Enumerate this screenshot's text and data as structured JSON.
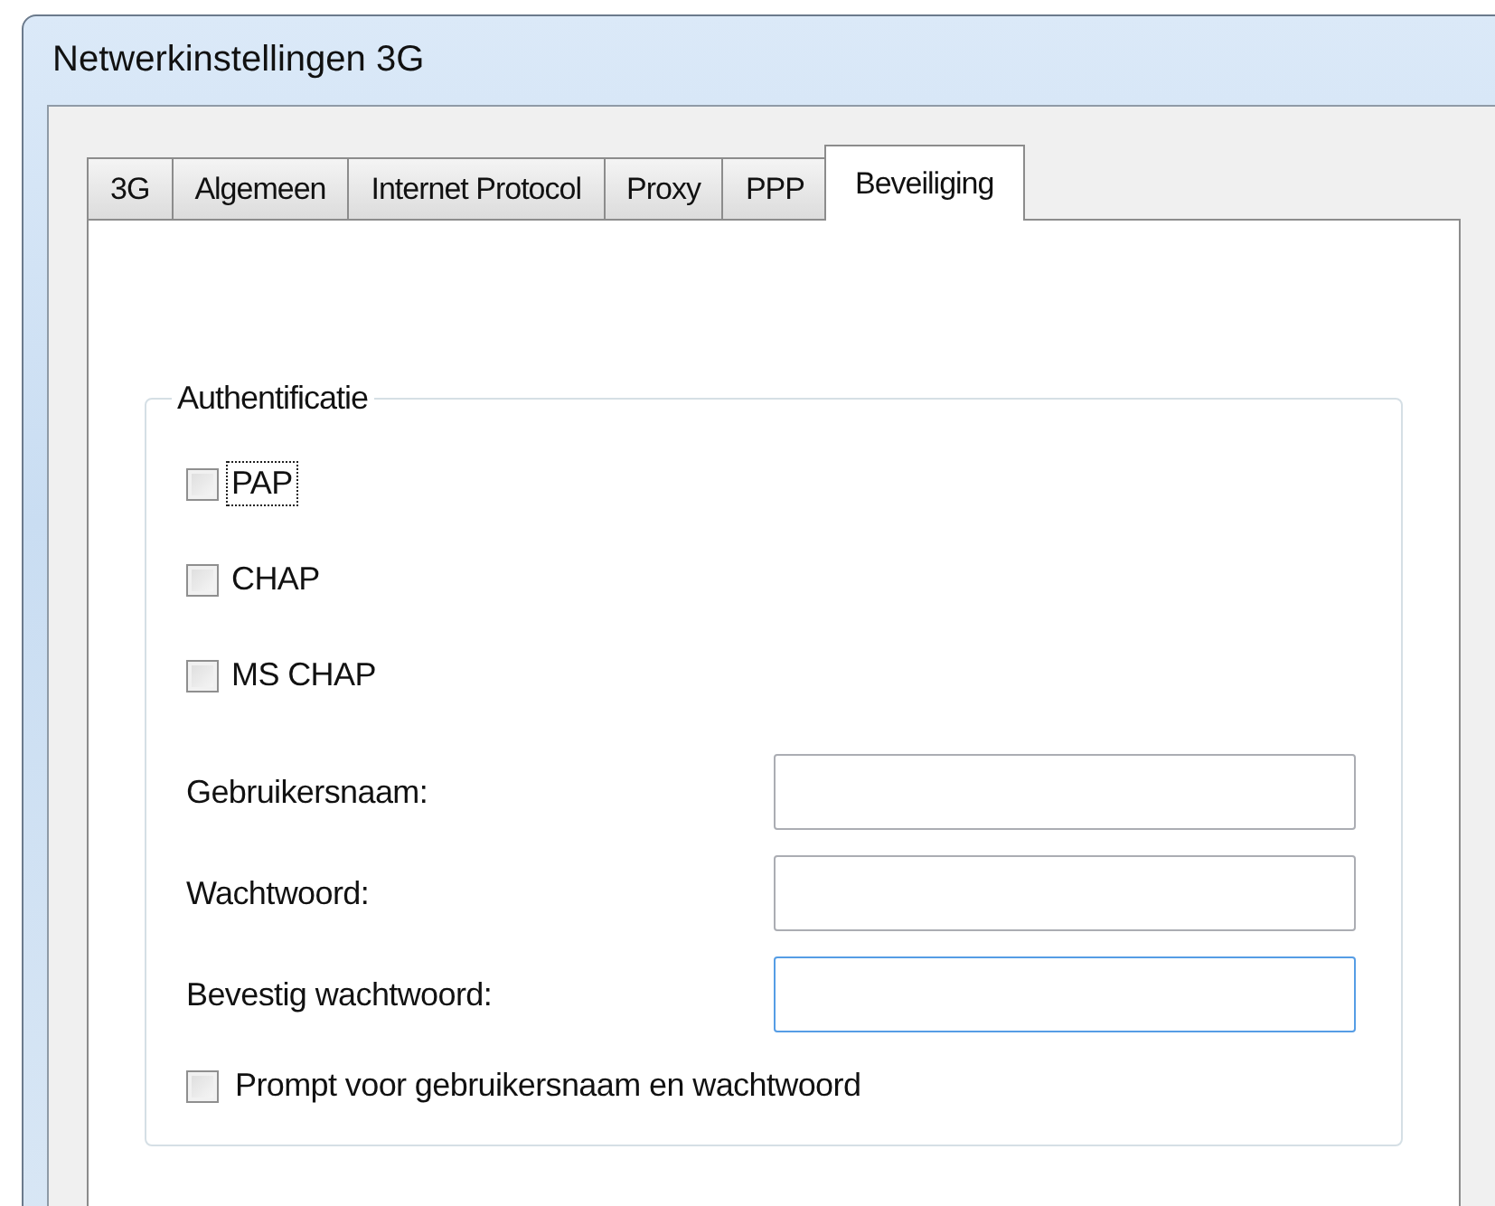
{
  "window": {
    "title": "Netwerkinstellingen 3G"
  },
  "tabs": [
    {
      "label": "3G",
      "selected": false
    },
    {
      "label": "Algemeen",
      "selected": false
    },
    {
      "label": "Internet Protocol",
      "selected": false
    },
    {
      "label": "Proxy",
      "selected": false
    },
    {
      "label": "PPP",
      "selected": false
    },
    {
      "label": "Beveiliging",
      "selected": true
    }
  ],
  "group": {
    "title": "Authentificatie",
    "protocols": [
      {
        "label": "PAP",
        "checked": false,
        "focused": true
      },
      {
        "label": "CHAP",
        "checked": false,
        "focused": false
      },
      {
        "label": "MS CHAP",
        "checked": false,
        "focused": false
      }
    ],
    "fields": [
      {
        "label": "Gebruikersnaam:",
        "focused": false
      },
      {
        "label": "Wachtwoord:",
        "focused": false
      },
      {
        "label": "Bevestig wachtwoord:",
        "focused": true
      }
    ],
    "prompt": {
      "label": "Prompt voor gebruikersnaam en wachtwoord",
      "checked": false,
      "focused": false
    }
  }
}
